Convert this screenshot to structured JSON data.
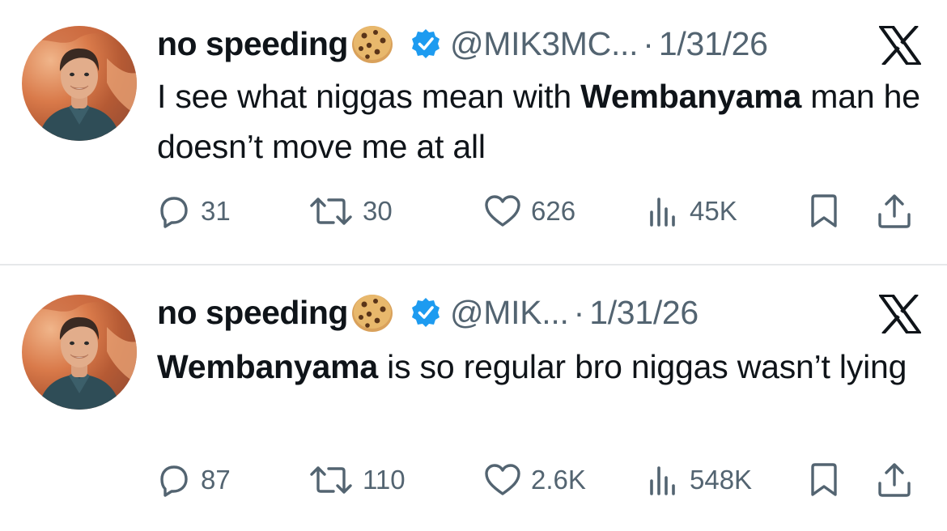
{
  "tweets": [
    {
      "name": "no speeding",
      "handle": "@MIK3MC...",
      "separator": "·",
      "date": "1/31/26",
      "body": {
        "pre": "I see what niggas mean with ",
        "bold": "Wembanyama",
        "post": " man he doesn’t move me at all"
      },
      "stats": {
        "replies": "31",
        "retweets": "30",
        "likes": "626",
        "views": "45K"
      }
    },
    {
      "name": "no speeding",
      "handle": "@MIK...",
      "separator": "·",
      "date": "1/31/26",
      "body": {
        "pre": "",
        "bold": "Wembanyama",
        "post": " is so regular bro niggas wasn’t lying"
      },
      "stats": {
        "replies": "87",
        "retweets": "110",
        "likes": "2.6K",
        "views": "548K"
      }
    }
  ],
  "icons": {
    "avatar": "profile-photo",
    "name_emoji": "cookie-icon",
    "verified": "verified-badge-icon",
    "platform": "x-logo-icon",
    "actions": [
      "reply-icon",
      "retweet-icon",
      "like-icon",
      "views-icon",
      "bookmark-icon",
      "share-icon"
    ]
  },
  "colors": {
    "text": "#0f1419",
    "secondary": "#536471",
    "verified": "#1d9bf0",
    "divider": "#e6e8ea"
  }
}
